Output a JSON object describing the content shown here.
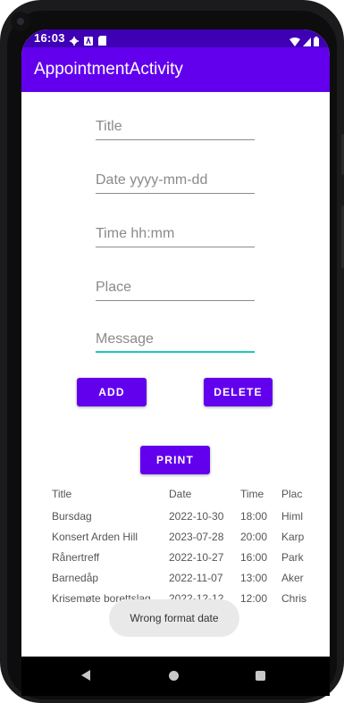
{
  "status_bar": {
    "time": "16:03"
  },
  "app_bar": {
    "title": "AppointmentActivity"
  },
  "form": {
    "title_placeholder": "Title",
    "date_placeholder": "Date yyyy-mm-dd",
    "time_placeholder": "Time hh:mm",
    "place_placeholder": "Place",
    "message_placeholder": "Message"
  },
  "buttons": {
    "add": "ADD",
    "delete": "DELETE",
    "print": "PRINT"
  },
  "table": {
    "headers": [
      "Title",
      "Date",
      "Time",
      "Plac"
    ],
    "rows": [
      [
        "Bursdag",
        "2022-10-30",
        "18:00",
        "Himl"
      ],
      [
        "Konsert Arden Hill",
        "2023-07-28",
        "20:00",
        "Karp"
      ],
      [
        "Rånertreff",
        "2022-10-27",
        "16:00",
        "Park"
      ],
      [
        "Barnedåp",
        "2022-11-07",
        "13:00",
        "Aker"
      ],
      [
        "Krisemøte borettslag",
        "2022-12-12",
        "12:00",
        "Chris"
      ]
    ]
  },
  "toast": {
    "message": "Wrong format date"
  },
  "colors": {
    "status_bar": "#3f00b5",
    "app_bar": "#6200ee",
    "button": "#6200ee",
    "focus_line": "#1ac9b8"
  },
  "icons": [
    "gear-icon",
    "a-icon",
    "sd-card-icon",
    "wifi-icon",
    "signal-icon",
    "battery-icon",
    "back-icon",
    "home-icon",
    "recents-icon"
  ]
}
